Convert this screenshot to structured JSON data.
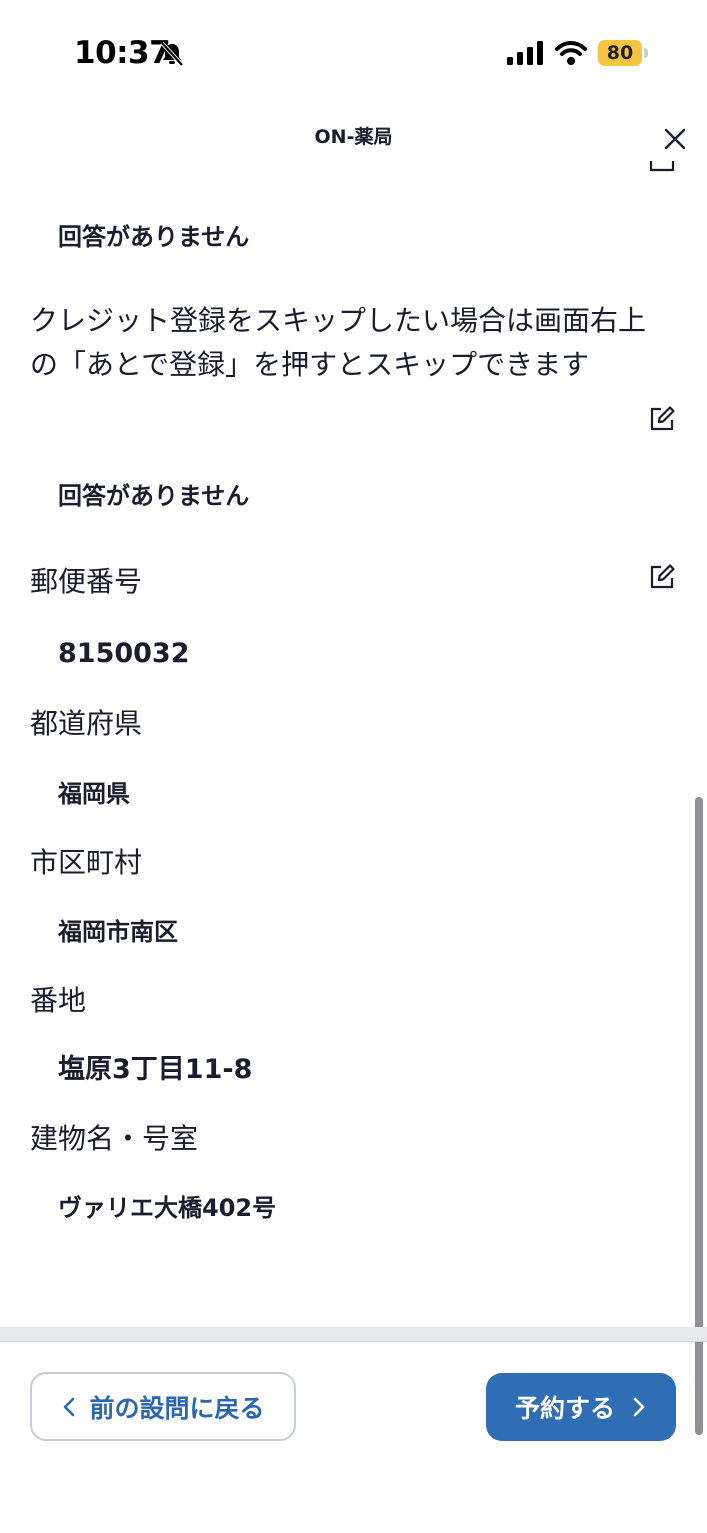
{
  "status_bar": {
    "time": "10:37",
    "battery": "80"
  },
  "header": {
    "title": "ON-薬局"
  },
  "icons": {
    "close": "close-icon",
    "edit": "edit-icon",
    "bell_off": "bell-slash-icon",
    "signal": "cellular-signal-icon",
    "wifi": "wifi-icon",
    "battery": "battery-icon"
  },
  "items": [
    {
      "answer": "回答がありません"
    },
    {
      "question": "クレジット登録をスキップしたい場合は画面右上の「あとで登録」を押すとスキップできます",
      "answer": "回答がありません"
    },
    {
      "question": "郵便番号",
      "answer": "8150032"
    },
    {
      "question": "都道府県",
      "answer": "福岡県"
    },
    {
      "question": "市区町村",
      "answer": "福岡市南区"
    },
    {
      "question": "番地",
      "answer": "塩原3丁目11-8"
    },
    {
      "question": "建物名・号室",
      "answer": "ヴァリエ大橋402号"
    }
  ],
  "footer": {
    "back_label": "前の設問に戻る",
    "reserve_label": "予約する"
  },
  "colors": {
    "primary": "#2f6db5",
    "text": "#1b1d2e",
    "battery": "#f5c542"
  }
}
